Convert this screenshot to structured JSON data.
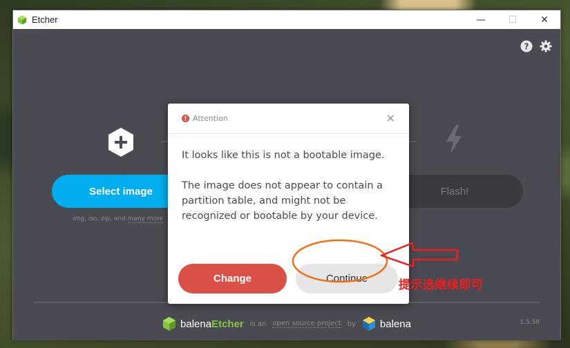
{
  "window": {
    "title": "Etcher",
    "controls": {
      "minimize": "—",
      "maximize": "☐",
      "close": "✕"
    }
  },
  "main": {
    "select_button": "Select image",
    "flash_button": "Flash!",
    "formats_text": "img, iso, zip, and",
    "formats_more": "many more"
  },
  "footer": {
    "brand_prefix": "balena",
    "brand_accent": "Etcher",
    "is_an": "is an",
    "open_source_link": "open source project",
    "by": "by",
    "company": "balena",
    "version": "1.5.58"
  },
  "modal": {
    "title": "Attention",
    "close": "✕",
    "paragraph1": "It looks like this is not a bootable image.",
    "paragraph2": "The image does not appear to contain a partition table, and might not be recognized or bootable by your device.",
    "change_button": "Change",
    "continue_button": "Continue"
  },
  "annotation": {
    "text": "提示选继续即可",
    "color": "#ee1c1c"
  },
  "colors": {
    "accent": "#00aeef",
    "danger": "#db5047",
    "brand_green": "#85c540",
    "background": "#4a4a52"
  },
  "icons": [
    "etcher-logo-icon",
    "help-icon",
    "settings-icon",
    "plus-icon",
    "flash-icon",
    "attention-icon",
    "balena-cube-icon"
  ]
}
